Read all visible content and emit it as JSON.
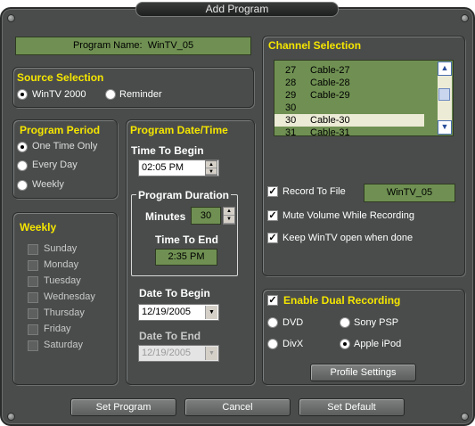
{
  "window": {
    "title": "Add Program"
  },
  "program_name": {
    "label": "Program Name:",
    "value": "WinTV_05"
  },
  "source_selection": {
    "title": "Source Selection",
    "options": [
      {
        "label": "WinTV 2000",
        "selected": true
      },
      {
        "label": "Reminder",
        "selected": false
      }
    ]
  },
  "program_period": {
    "title": "Program Period",
    "options": [
      {
        "label": "One Time Only",
        "selected": true
      },
      {
        "label": "Every Day",
        "selected": false
      },
      {
        "label": "Weekly",
        "selected": false
      }
    ]
  },
  "weekly": {
    "title": "Weekly",
    "days": [
      "Sunday",
      "Monday",
      "Tuesday",
      "Wednesday",
      "Thursday",
      "Friday",
      "Saturday"
    ]
  },
  "date_time": {
    "title": "Program Date/Time",
    "time_to_begin_label": "Time To Begin",
    "time_to_begin": "02:05 PM",
    "duration_title": "Program Duration",
    "minutes_label": "Minutes",
    "minutes": "30",
    "time_to_end_label": "Time To End",
    "time_to_end": "2:35 PM",
    "date_to_begin_label": "Date To Begin",
    "date_to_begin": "12/19/2005",
    "date_to_end_label": "Date To End",
    "date_to_end": "12/19/2005"
  },
  "channel_selection": {
    "title": "Channel Selection",
    "channels": [
      {
        "num": "27",
        "name": "Cable-27"
      },
      {
        "num": "28",
        "name": "Cable-28"
      },
      {
        "num": "29",
        "name": "Cable-29"
      },
      {
        "num": "30",
        "name": ""
      },
      {
        "num": "30",
        "name": "Cable-30",
        "selected": true
      },
      {
        "num": "31",
        "name": "Cable-31"
      }
    ]
  },
  "recording": {
    "record_to_file_label": "Record To File",
    "record_to_file_value": "WinTV_05",
    "mute_label": "Mute Volume While Recording",
    "keep_open_label": "Keep WinTV open when done"
  },
  "dual": {
    "title": "Enable Dual Recording",
    "options": [
      {
        "label": "DVD",
        "selected": false
      },
      {
        "label": "Sony PSP",
        "selected": false
      },
      {
        "label": "DivX",
        "selected": false
      },
      {
        "label": "Apple iPod",
        "selected": true
      }
    ],
    "profile_button": "Profile Settings"
  },
  "buttons": {
    "set_program": "Set Program",
    "cancel": "Cancel",
    "set_default": "Set Default"
  },
  "colors": {
    "panel": "#4a4c4c",
    "accent_yellow": "#f5e600",
    "lcd_green": "#6f9052"
  },
  "icons": {
    "check": "✓",
    "up": "▲",
    "down": "▼"
  }
}
